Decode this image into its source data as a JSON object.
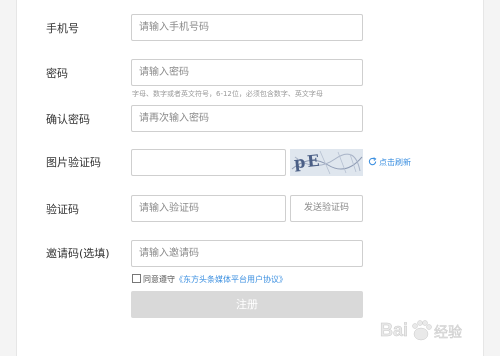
{
  "form": {
    "phone": {
      "label": "手机号",
      "placeholder": "请输入手机号码"
    },
    "password": {
      "label": "密码",
      "placeholder": "请输入密码",
      "hint": "字母、数字或者英文符号，6-12位，必须包含数字、英文字母"
    },
    "confirm": {
      "label": "确认密码",
      "placeholder": "请再次输入密码"
    },
    "captcha": {
      "label": "图片验证码",
      "value": "",
      "image_text": "pE",
      "refresh": "点击刷新"
    },
    "code": {
      "label": "验证码",
      "placeholder": "请输入验证码",
      "send_button": "发送验证码"
    },
    "invite": {
      "label": "邀请码(选填)",
      "placeholder": "请输入邀请码"
    },
    "agreement": {
      "prefix": "同意遵守",
      "link": "《东方头条媒体平台用户协议》",
      "checked": false
    },
    "register_button": "注册"
  },
  "watermark": {
    "text": "Baidu 经验"
  },
  "colors": {
    "link": "#3b8fe0",
    "disabled_button": "#d9d9d9",
    "border": "#cfcfcf"
  }
}
